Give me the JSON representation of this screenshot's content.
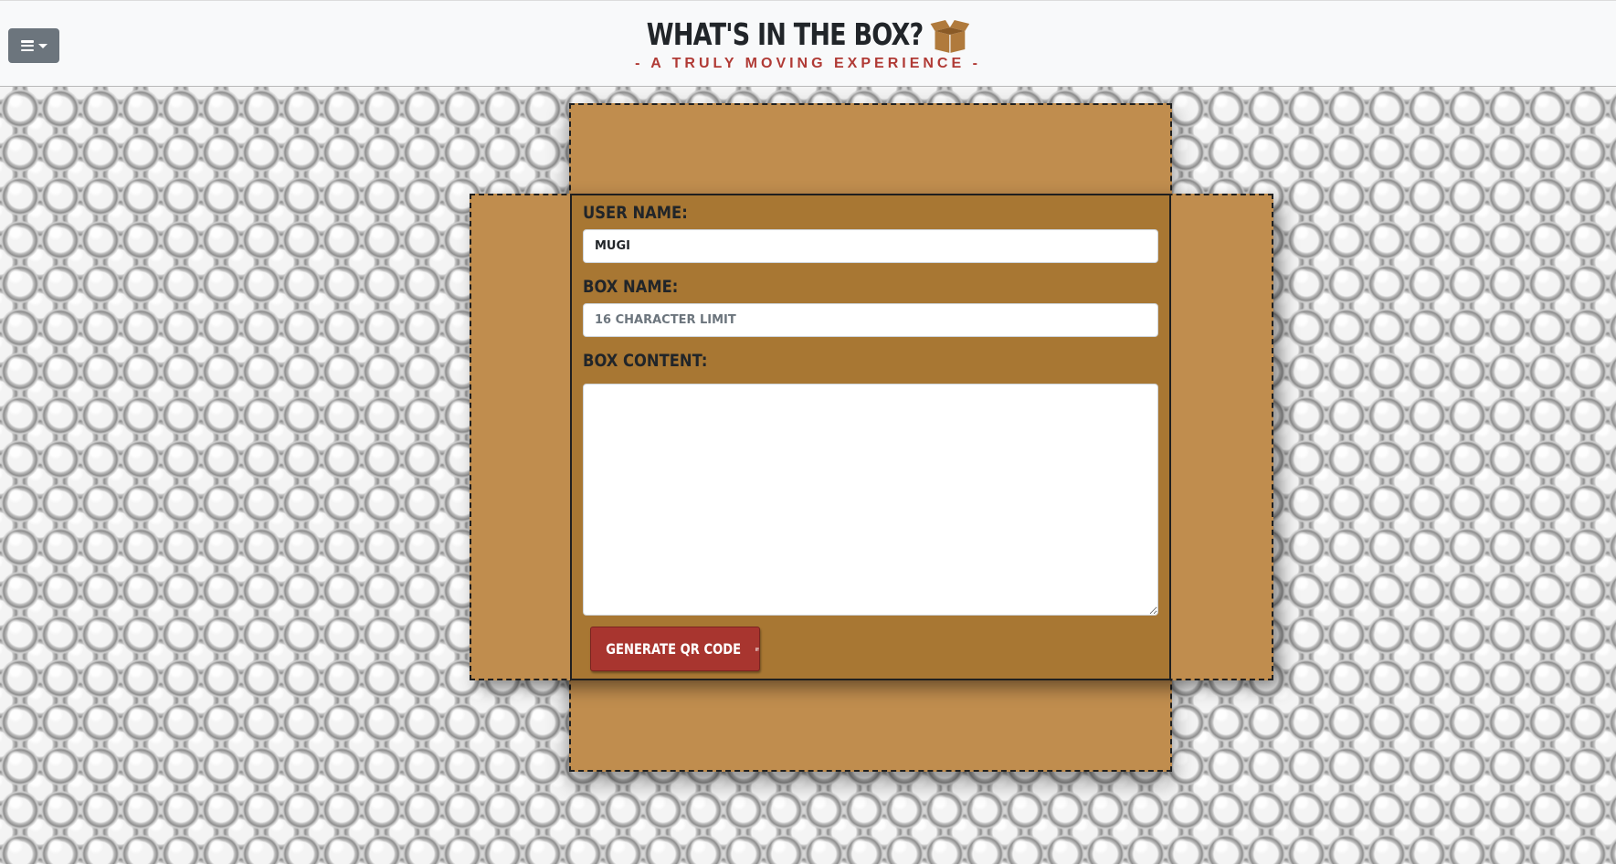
{
  "header": {
    "menu_icon": "bars-icon",
    "title": "What's in the Box?",
    "title_icon": "open-box-icon",
    "subtitle": "- A Truly Moving Experience -"
  },
  "form": {
    "user_name_label": "User Name:",
    "user_name_value": "Mugi",
    "box_name_label": "Box Name:",
    "box_name_placeholder": "16 character limit",
    "box_content_label": "Box Content:",
    "box_content_value": "",
    "generate_button_label": "Generate QR Code",
    "generate_button_icon": "qrcode-icon"
  },
  "colors": {
    "header_bg": "#f8f9fa",
    "box_flap": "#c08d4e",
    "box_center": "#a87733",
    "button": "#a8352f",
    "subtitle": "#b03a35",
    "menu_button": "#6c757d"
  }
}
